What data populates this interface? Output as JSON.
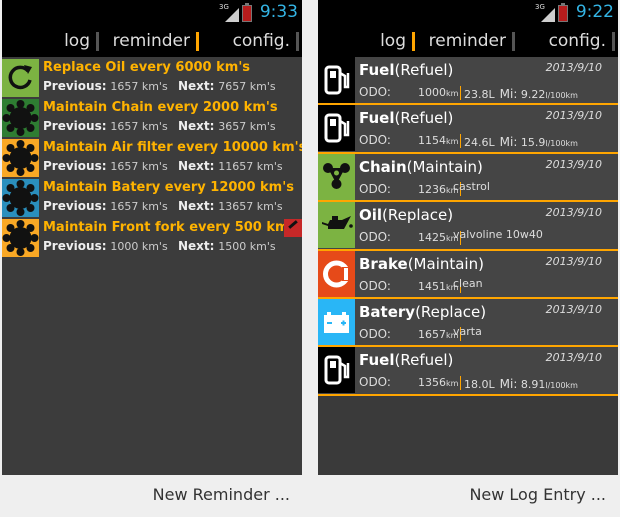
{
  "left_screen": {
    "status": {
      "signal_label": "3G",
      "time": "9:33"
    },
    "tabs": [
      {
        "label": "log"
      },
      {
        "label": "reminder"
      },
      {
        "label": "config."
      }
    ],
    "reminders": [
      {
        "icon": "refresh-icon",
        "color": "#7cb342",
        "title": "Replace Oil every 6000 km's",
        "previous_label": "Previous:",
        "previous": "1657 km's",
        "next_label": "Next:",
        "next": "7657 km's"
      },
      {
        "icon": "chain-sprocket-icon",
        "color": "#2e7d32",
        "title": "Maintain Chain every 2000 km's",
        "previous_label": "Previous:",
        "previous": "1657 km's",
        "next_label": "Next:",
        "next": "3657 km's"
      },
      {
        "icon": "air-filter-sprocket-icon",
        "color": "#f9a825",
        "title": "Maintain Air filter every 10000 km's",
        "previous_label": "Previous:",
        "previous": "1657 km's",
        "next_label": "Next:",
        "next": "11657 km's"
      },
      {
        "icon": "battery-sprocket-icon",
        "color": "#2a8fbd",
        "title": "Maintain Batery every 12000 km's",
        "previous_label": "Previous:",
        "previous": "1657 km's",
        "next_label": "Next:",
        "next": "13657 km's"
      },
      {
        "icon": "fork-sprocket-icon",
        "color": "#f9a825",
        "title": "Maintain Front fork every 500 km's",
        "previous_label": "Previous:",
        "previous": "1000 km's",
        "next_label": "Next:",
        "next": "1500 km's"
      }
    ],
    "footer_button": "New Reminder ..."
  },
  "right_screen": {
    "status": {
      "signal_label": "3G",
      "time": "9:22"
    },
    "tabs": [
      {
        "label": "log"
      },
      {
        "label": "reminder"
      },
      {
        "label": "config."
      }
    ],
    "logs": [
      {
        "icon": "fuel-pump-icon",
        "name": "Fuel",
        "kind": "(Refuel)",
        "date": "2013/9/10",
        "odo_label": "ODO:",
        "odo": "1000",
        "odo_unit": "km",
        "liters": "23.8L",
        "mi_label": "Mi:",
        "mi": "9.22",
        "mi_unit": "l/100km"
      },
      {
        "icon": "fuel-pump-icon",
        "name": "Fuel",
        "kind": "(Refuel)",
        "date": "2013/9/10",
        "odo_label": "ODO:",
        "odo": "1154",
        "odo_unit": "km",
        "liters": "24.6L",
        "mi_label": "Mi:",
        "mi": "15.9",
        "mi_unit": "l/100km"
      },
      {
        "icon": "chain-icon",
        "name": "Chain",
        "kind": "(Maintain)",
        "date": "2013/9/10",
        "odo_label": "ODO:",
        "odo": "1236",
        "odo_unit": "km",
        "note": "castrol"
      },
      {
        "icon": "oil-can-icon",
        "name": "Oil",
        "kind": "(Replace)",
        "date": "2013/9/10",
        "odo_label": "ODO:",
        "odo": "1425",
        "odo_unit": "km",
        "note": "valvoline 10w40"
      },
      {
        "icon": "brake-disc-icon",
        "name": "Brake",
        "kind": "(Maintain)",
        "date": "2013/9/10",
        "odo_label": "ODO:",
        "odo": "1451",
        "odo_unit": "km",
        "note": "clean"
      },
      {
        "icon": "car-battery-icon",
        "name": "Batery",
        "kind": "(Replace)",
        "date": "2013/9/10",
        "odo_label": "ODO:",
        "odo": "1657",
        "odo_unit": "km",
        "note": "varta"
      },
      {
        "icon": "fuel-pump-icon",
        "name": "Fuel",
        "kind": "(Refuel)",
        "date": "2013/9/10",
        "odo_label": "ODO:",
        "odo": "1356",
        "odo_unit": "km",
        "liters": "18.0L",
        "mi_label": "Mi:",
        "mi": "8.91",
        "mi_unit": "l/100km"
      }
    ],
    "footer_button": "New Log Entry ..."
  }
}
